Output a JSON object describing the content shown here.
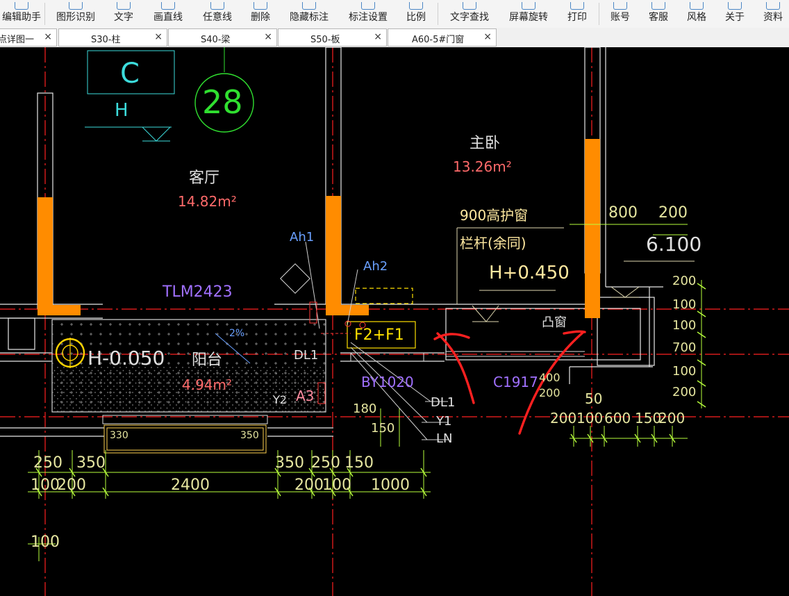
{
  "toolbar": {
    "items": [
      {
        "label": "编辑助手",
        "icon": "edit-assistant-icon"
      },
      {
        "label": "图形识别",
        "icon": "shape-recognition-icon"
      },
      {
        "label": "文字",
        "icon": "text-icon"
      },
      {
        "label": "画直线",
        "icon": "line-icon"
      },
      {
        "label": "任意线",
        "icon": "freeline-icon"
      },
      {
        "label": "删除",
        "icon": "eraser-icon"
      },
      {
        "label": "隐藏标注",
        "icon": "hide-annotation-icon"
      },
      {
        "label": "标注设置",
        "icon": "annotation-settings-icon"
      },
      {
        "label": "比例",
        "icon": "ruler-icon"
      },
      {
        "label": "文字查找",
        "icon": "text-search-icon"
      },
      {
        "label": "屏幕旋转",
        "icon": "rotate-screen-icon"
      },
      {
        "label": "打印",
        "icon": "printer-icon"
      },
      {
        "label": "账号",
        "icon": "account-icon"
      },
      {
        "label": "客服",
        "icon": "headset-icon"
      },
      {
        "label": "风格",
        "icon": "style-icon"
      },
      {
        "label": "关于",
        "icon": "info-icon"
      },
      {
        "label": "资料",
        "icon": "documents-icon"
      }
    ]
  },
  "tabs": [
    {
      "label": "点详图一",
      "close": "×"
    },
    {
      "label": "S30-柱",
      "close": "×"
    },
    {
      "label": "S40-梁",
      "close": "×"
    },
    {
      "label": "S50-板",
      "close": "×"
    },
    {
      "label": "A60-5#门窗",
      "close": "×"
    }
  ],
  "drawing": {
    "axis_bubble_c": "C",
    "axis_bubble_28": "28",
    "level_mark_h": "H",
    "living_room": {
      "name": "客厅",
      "area": "14.82m²"
    },
    "master_bedroom": {
      "name": "主卧",
      "area": "13.26m²"
    },
    "balcony": {
      "name": "阳台",
      "area": "4.94m²",
      "level": "H-0.050"
    },
    "guard_window_note": "900高护窗",
    "railing_note": "栏杆(余同)",
    "floor_level": "H+0.450",
    "bay_window": "凸窗",
    "level_6100": "6.100",
    "door_tlm": "TLM2423",
    "window_c": "C1917",
    "labels": [
      "Ah1",
      "Ah2",
      "DL1",
      "A3",
      "Y2",
      "BY1020",
      "DL1",
      "Y1",
      "LN",
      "F2+F1",
      "2%"
    ],
    "dims_top_right": [
      "800",
      "200"
    ],
    "dims_right_vertical": [
      "200",
      "100",
      "100",
      "700",
      "100",
      "200"
    ],
    "dims_bay_vertical": [
      "400",
      "200"
    ],
    "dims_bottom_right": [
      "50",
      "200",
      "100",
      "600",
      "150",
      "200"
    ],
    "dims_balcony_vertical": [
      "180",
      "150"
    ],
    "dims_row1": [
      "250",
      "350",
      "350",
      "250",
      "150"
    ],
    "dims_row2": [
      "100",
      "200",
      "2400",
      "200",
      "100",
      "1000"
    ],
    "dims_left_vertical": [
      "100"
    ],
    "dims_window_bars": [
      "330",
      "350"
    ]
  },
  "colors": {
    "canvas_bg": "#000000",
    "wall_fill": "#ff8c00",
    "axis_line": "#ff2020",
    "dim_line": "#b8ff3c",
    "room_text": "#e0e0e0",
    "area_text": "#ff6a6a",
    "annotation_red": "#ff3030"
  }
}
